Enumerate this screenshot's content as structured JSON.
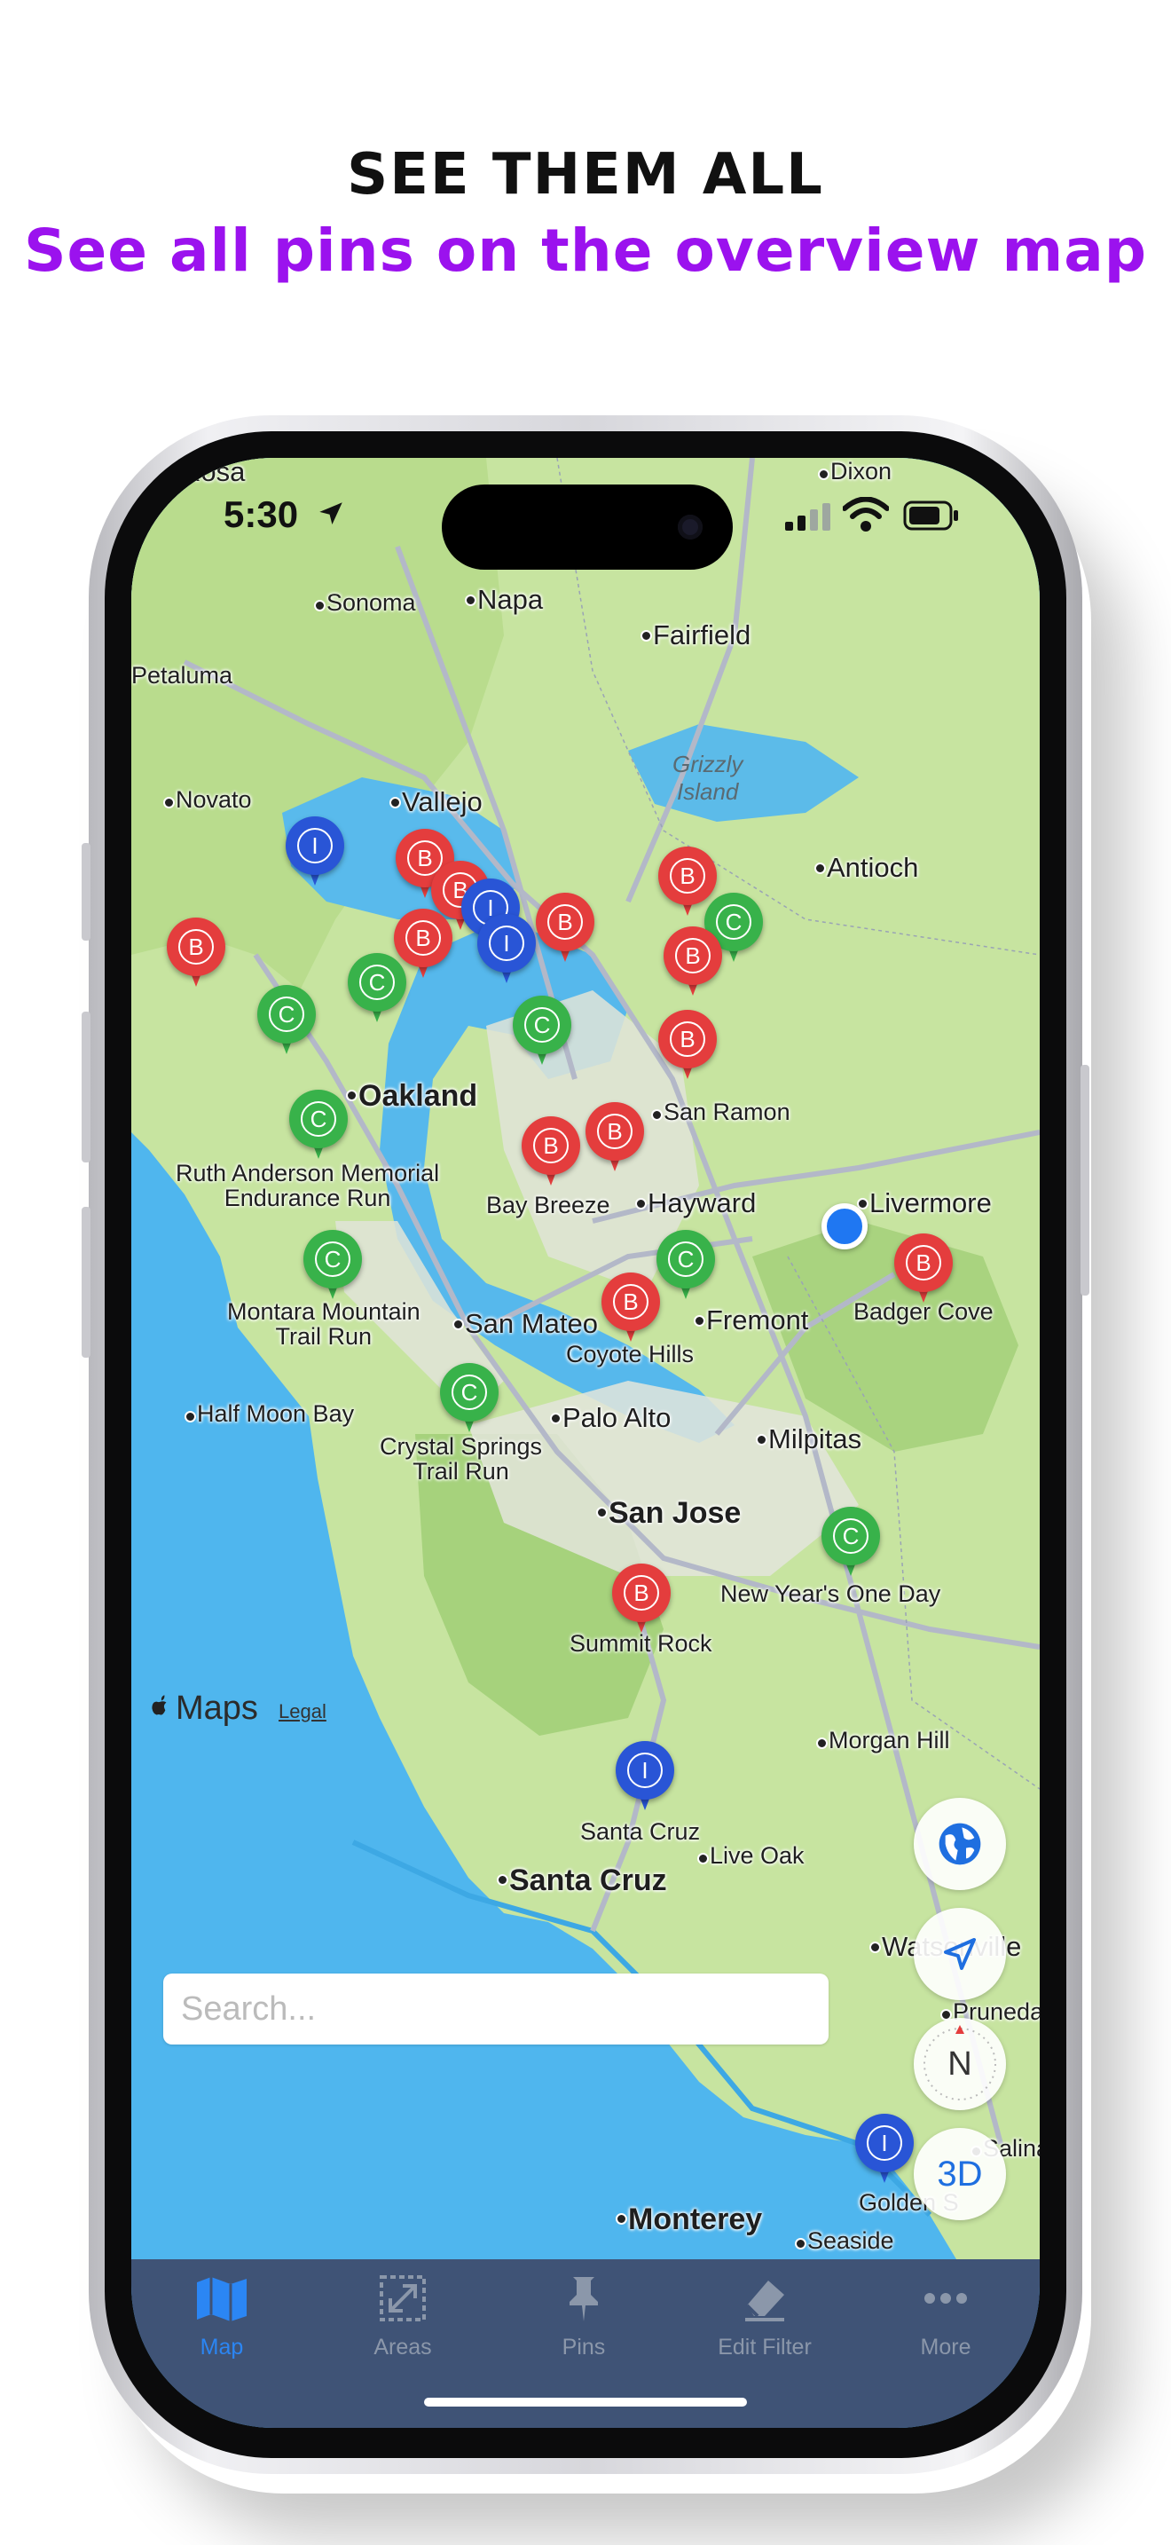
{
  "headline": "SEE THEM ALL",
  "subheadline": "See all pins on the overview map",
  "status_bar": {
    "time": "5:30"
  },
  "map": {
    "places": [
      {
        "text": "Rosa",
        "cls": "city"
      },
      {
        "text": "Dixon",
        "cls": ""
      },
      {
        "text": "Sonoma",
        "cls": ""
      },
      {
        "text": "Napa",
        "cls": "city"
      },
      {
        "text": "Fairfield",
        "cls": "city"
      },
      {
        "text": "Petaluma",
        "cls": ""
      },
      {
        "text": "Grizzly\nIsland",
        "cls": "water"
      },
      {
        "text": "Novato",
        "cls": ""
      },
      {
        "text": "Vallejo",
        "cls": "city"
      },
      {
        "text": "Antioch",
        "cls": "city"
      },
      {
        "text": "Oakland",
        "cls": "big"
      },
      {
        "text": "San Ramon",
        "cls": ""
      },
      {
        "text": "Hayward",
        "cls": "city"
      },
      {
        "text": "Livermore",
        "cls": "city"
      },
      {
        "text": "San Mateo",
        "cls": "city"
      },
      {
        "text": "Fremont",
        "cls": "city"
      },
      {
        "text": "Half Moon Bay",
        "cls": ""
      },
      {
        "text": "Palo Alto",
        "cls": "city"
      },
      {
        "text": "Milpitas",
        "cls": "city"
      },
      {
        "text": "San Jose",
        "cls": "big"
      },
      {
        "text": "Morgan Hill",
        "cls": ""
      },
      {
        "text": "Live Oak",
        "cls": ""
      },
      {
        "text": "Santa Cruz",
        "cls": "big"
      },
      {
        "text": "Watsonville",
        "cls": "city"
      },
      {
        "text": "Pruneda",
        "cls": ""
      },
      {
        "text": "Salinas",
        "cls": ""
      },
      {
        "text": "Monterey",
        "cls": "big"
      },
      {
        "text": "Seaside",
        "cls": ""
      }
    ],
    "pins": [
      {
        "letter": "I",
        "color": "blue"
      },
      {
        "letter": "B",
        "color": "red"
      },
      {
        "letter": "B",
        "color": "red"
      },
      {
        "letter": "I",
        "color": "blue"
      },
      {
        "letter": "I",
        "color": "blue"
      },
      {
        "letter": "B",
        "color": "red"
      },
      {
        "letter": "B",
        "color": "red"
      },
      {
        "letter": "B",
        "color": "red"
      },
      {
        "letter": "C",
        "color": "green"
      },
      {
        "letter": "B",
        "color": "red"
      },
      {
        "letter": "B",
        "color": "red"
      },
      {
        "letter": "C",
        "color": "green"
      },
      {
        "letter": "C",
        "color": "green"
      },
      {
        "letter": "C",
        "color": "green"
      },
      {
        "letter": "B",
        "color": "red"
      },
      {
        "letter": "C",
        "color": "green"
      },
      {
        "letter": "B",
        "color": "red"
      },
      {
        "letter": "B",
        "color": "red"
      },
      {
        "letter": "C",
        "color": "green"
      },
      {
        "letter": "C",
        "color": "green"
      },
      {
        "letter": "B",
        "color": "red"
      },
      {
        "letter": "B",
        "color": "red"
      },
      {
        "letter": "C",
        "color": "green"
      },
      {
        "letter": "C",
        "color": "green"
      },
      {
        "letter": "B",
        "color": "red"
      },
      {
        "letter": "I",
        "color": "blue"
      },
      {
        "letter": "I",
        "color": "blue"
      }
    ],
    "pin_labels": [
      "Ruth Anderson Memorial\nEndurance Run",
      "Bay Breeze",
      "Montara Mountain\nTrail Run",
      "Coyote Hills",
      "Badger Cove",
      "Crystal Springs\nTrail Run",
      "New Year's One Day",
      "Summit Rock",
      "Santa Cruz",
      "Golden S"
    ],
    "attribution": "Maps",
    "legal": "Legal",
    "colors": {
      "red": "#e43d3d",
      "green": "#38b24a",
      "blue": "#2955d6",
      "water": "#4fb6ee",
      "land": "#c9e6a4"
    }
  },
  "search": {
    "placeholder": "Search..."
  },
  "map_controls": {
    "globe_icon": "globe-icon",
    "locate_icon": "location-arrow-icon",
    "compass_label": "N",
    "three_d_label": "3D"
  },
  "tabbar": {
    "tabs": [
      {
        "label": "Map",
        "icon": "map-icon",
        "active": true
      },
      {
        "label": "Areas",
        "icon": "areas-icon",
        "active": false
      },
      {
        "label": "Pins",
        "icon": "pin-icon",
        "active": false
      },
      {
        "label": "Edit Filter",
        "icon": "eraser-icon",
        "active": false
      },
      {
        "label": "More",
        "icon": "ellipsis-icon",
        "active": false
      }
    ]
  }
}
